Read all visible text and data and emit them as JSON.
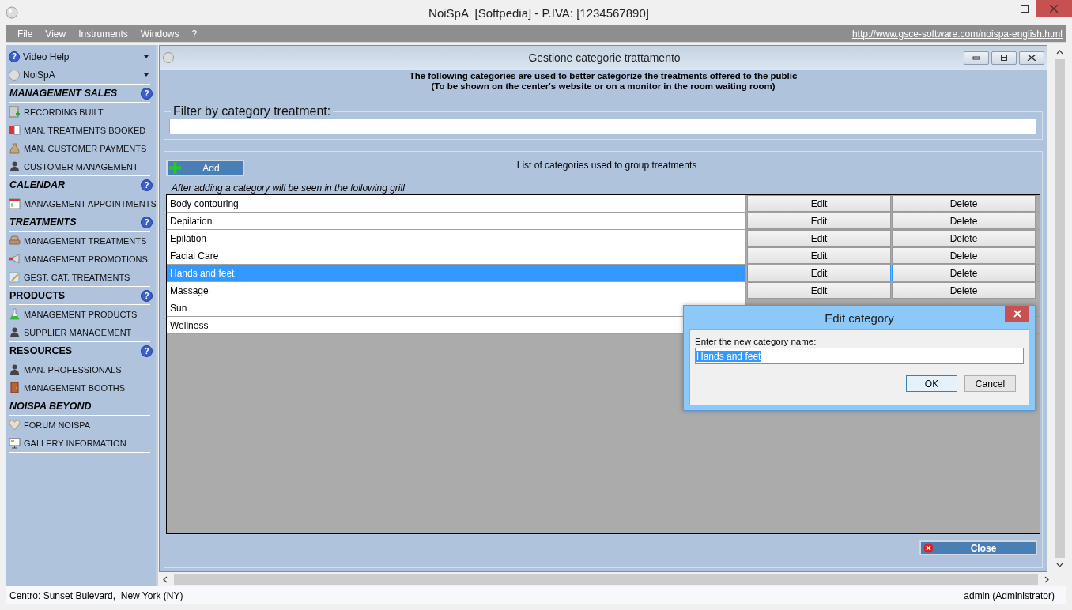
{
  "window": {
    "title": "NoiSpA  [Softpedia] - P.IVA: [1234567890]"
  },
  "menu": [
    "File",
    "View",
    "Instruments",
    "Windows",
    "?"
  ],
  "website_link": "http://www.gsce-software.com/noispa-english.html",
  "sidebar": {
    "dropdowns": [
      {
        "label": "Video Help",
        "badge": "?"
      },
      {
        "label": "NoiSpA"
      }
    ],
    "sections": [
      {
        "title": "MANAGEMENT SALES",
        "italic": true,
        "help": "?",
        "items": [
          "RECORDING BUILT",
          "MAN. TREATMENTS BOOKED",
          "MAN. CUSTOMER PAYMENTS",
          "CUSTOMER MANAGEMENT"
        ]
      },
      {
        "title": "CALENDAR",
        "italic": true,
        "help": "?",
        "items": [
          "MANAGEMENT APPOINTMENTS"
        ]
      },
      {
        "title": "TREATMENTS",
        "italic": true,
        "help": "?",
        "items": [
          "MANAGEMENT TREATMENTS",
          "MANAGEMENT PROMOTIONS",
          "GEST. CAT. TREATMENTS"
        ]
      },
      {
        "title": "PRODUCTS",
        "italic": false,
        "help": "?",
        "items": [
          "MANAGEMENT PRODUCTS",
          "SUPPLIER MANAGEMENT"
        ]
      },
      {
        "title": "RESOURCES",
        "italic": false,
        "help": "?",
        "items": [
          "MAN. PROFESSIONALS",
          "MANAGEMENT BOOTHS"
        ]
      },
      {
        "title": "NOISPA BEYOND",
        "italic": true,
        "items": [
          "FORUM NOISPA",
          "GALLERY INFORMATION"
        ]
      }
    ]
  },
  "child_window": {
    "title": "Gestione categorie trattamento",
    "description": [
      "The following categories are used to better categorize the treatments offered to the public",
      "(To be shown on the center's website or on a monitor in the room waiting room)"
    ],
    "filter": {
      "label": "Filter by category treatment:"
    },
    "add_button": "Add",
    "caption": "List of categories used to group treatments",
    "note": "After adding a category will be seen in the following grill",
    "rows": [
      {
        "name": "Body contouring",
        "selected": false,
        "edit": "Edit",
        "delete": "Delete"
      },
      {
        "name": "Depilation",
        "selected": false,
        "edit": "Edit",
        "delete": "Delete"
      },
      {
        "name": "Epilation",
        "selected": false,
        "edit": "Edit",
        "delete": "Delete"
      },
      {
        "name": "Facial Care",
        "selected": false,
        "edit": "Edit",
        "delete": "Delete"
      },
      {
        "name": "Hands and feet",
        "selected": true,
        "edit": "Edit",
        "delete": "Delete"
      },
      {
        "name": "Massage",
        "selected": false,
        "edit": "Edit",
        "delete": "Delete"
      },
      {
        "name": "Sun",
        "selected": false
      },
      {
        "name": "Wellness",
        "selected": false
      }
    ],
    "close_button": "Close"
  },
  "dialog": {
    "title": "Edit category",
    "label": "Enter the new category name:",
    "value": "Hands and feet",
    "text_selected": true,
    "buttons": [
      {
        "label": "OK",
        "default": true
      },
      {
        "label": "Cancel",
        "default": false
      }
    ]
  },
  "status_bar": {
    "left": "Centro: Sunset Bulevard,  New York (NY)",
    "right": "admin (Administrator)"
  }
}
